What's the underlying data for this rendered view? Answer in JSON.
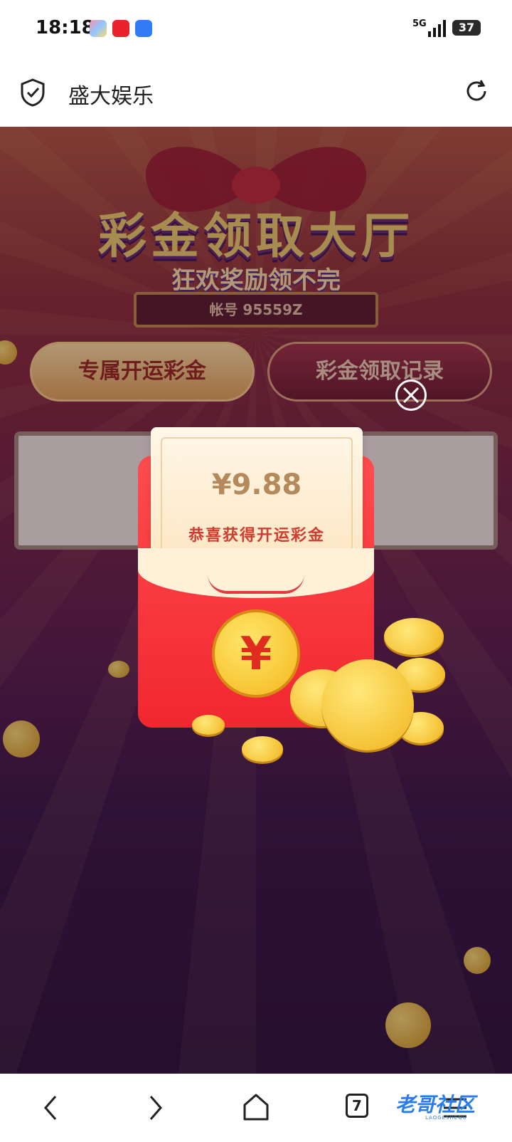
{
  "status_bar": {
    "time": "18:18",
    "network": "5G",
    "battery": "37"
  },
  "browser": {
    "site_title": "盛大娱乐"
  },
  "page": {
    "hall_title": "彩金领取大厅",
    "hall_subtitle": "狂欢奖励领不完",
    "account_label": "帐号 95559Z",
    "tabs": [
      {
        "label": "专属开运彩金"
      },
      {
        "label": "彩金领取记录"
      }
    ]
  },
  "popup": {
    "amount": "¥9.88",
    "message": "恭喜获得开运彩金",
    "coin_symbol": "¥"
  },
  "bottom_nav": {
    "tab_count": "7"
  },
  "watermark": {
    "text": "老哥社区",
    "sub": "LAOGESHEQU"
  },
  "colors": {
    "envelope_red": "#f1272f",
    "coin_gold": "#f4b71c",
    "title_gold": "#f2d36a"
  }
}
